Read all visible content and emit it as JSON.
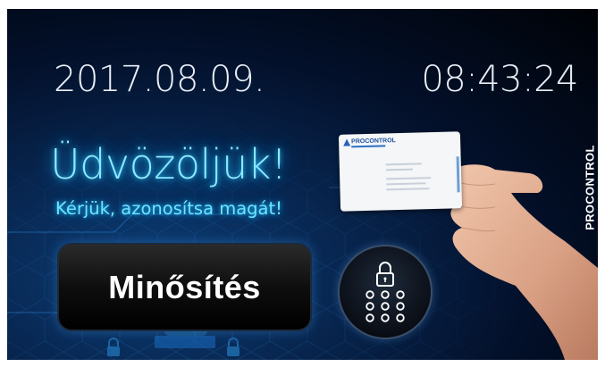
{
  "screen": {
    "date": "2017.08.09.",
    "time": "08:43:24",
    "welcome": "Üdvözöljük!",
    "subtitle": "Kérjük, azonosítsa magát!",
    "qualify_button_label": "Minősítés",
    "brand_vertical": "PROCONTROL"
  },
  "card": {
    "brand": "PROCONTROL"
  },
  "colors": {
    "accent_glow": "#23bff2",
    "button_bg": "#0e0e0e",
    "background_dark": "#03102a"
  },
  "icons": [
    "padlock-icon",
    "keypad-icon",
    "hand-image",
    "access-card-image"
  ]
}
